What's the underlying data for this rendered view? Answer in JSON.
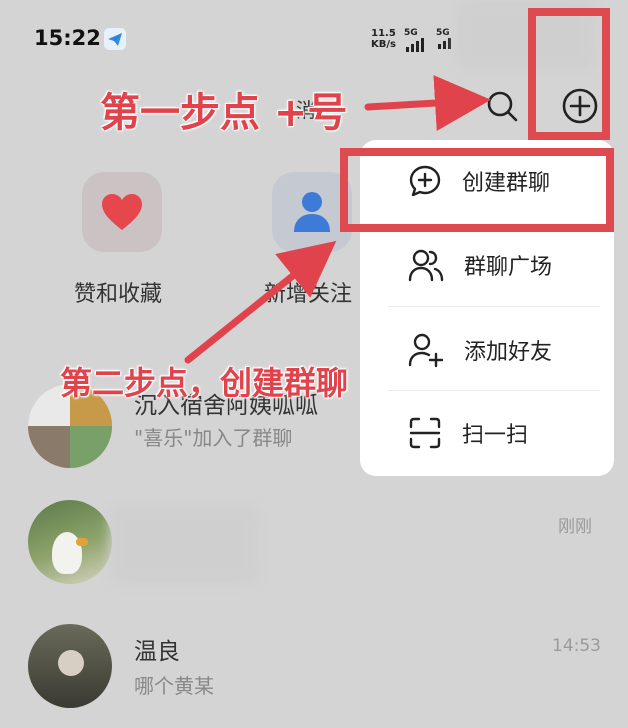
{
  "status_bar": {
    "time": "15:22",
    "net_speed_value": "11.5",
    "net_speed_unit": "KB/s",
    "signal1": "5G",
    "signal2": "5G"
  },
  "header": {
    "partial_title": "消"
  },
  "quick_entries": [
    {
      "label": "赞和收藏",
      "icon": "heart-icon"
    },
    {
      "label": "新增关注",
      "icon": "person-icon"
    }
  ],
  "menu": {
    "items": [
      {
        "label": "创建群聊",
        "icon": "chat-plus-icon"
      },
      {
        "label": "群聊广场",
        "icon": "group-icon"
      },
      {
        "label": "添加好友",
        "icon": "add-friend-icon"
      },
      {
        "label": "扫一扫",
        "icon": "scan-icon"
      }
    ]
  },
  "annotations": {
    "step1": "第一步点 +号",
    "step2": "第二步点，创建群聊"
  },
  "chats": [
    {
      "title": "沉入宿舍阿姨呱呱",
      "subtitle": "\"喜乐\"加入了群聊",
      "time": ""
    },
    {
      "title": "",
      "subtitle": "",
      "time": "刚刚"
    },
    {
      "title": "温良",
      "subtitle": "哪个黄某",
      "time": "14:53"
    }
  ],
  "colors": {
    "annotation_red": "#e0434b",
    "heart_red": "#e5474d",
    "person_blue": "#3e7bd6"
  }
}
